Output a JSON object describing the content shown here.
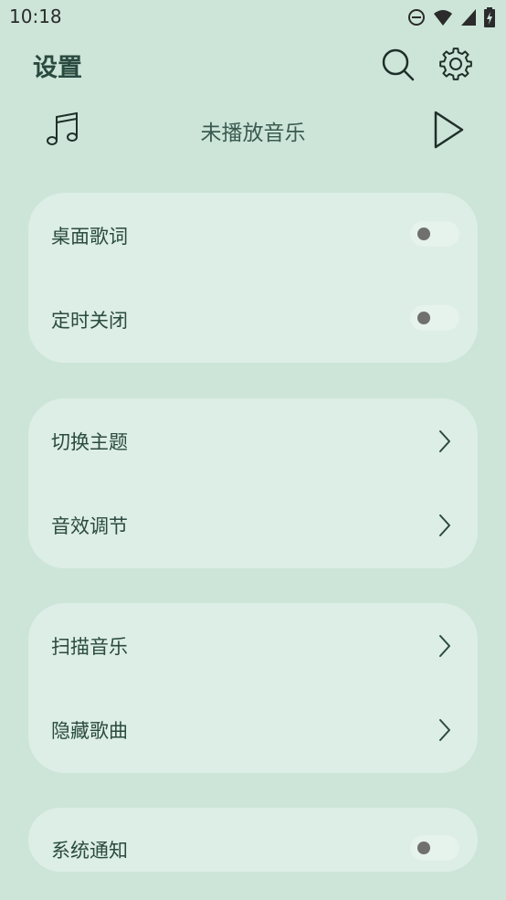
{
  "colors": {
    "background": "#cde5d9",
    "card": "#ddeee6",
    "accent": "#2a4a40"
  },
  "status_bar": {
    "time": "10:18",
    "icons": [
      "dnd-icon",
      "wifi-icon",
      "signal-icon",
      "battery-charging-icon"
    ]
  },
  "header": {
    "title": "设置",
    "icons": [
      "search-icon",
      "gear-icon"
    ]
  },
  "player": {
    "status": "未播放音乐",
    "icons": [
      "music-note-icon",
      "play-icon"
    ]
  },
  "cards": [
    {
      "rows": [
        {
          "label": "桌面歌词",
          "type": "toggle",
          "on": false
        },
        {
          "label": "定时关闭",
          "type": "toggle",
          "on": false
        }
      ]
    },
    {
      "rows": [
        {
          "label": "切换主题",
          "type": "link"
        },
        {
          "label": "音效调节",
          "type": "link"
        }
      ]
    },
    {
      "rows": [
        {
          "label": "扫描音乐",
          "type": "link"
        },
        {
          "label": "隐藏歌曲",
          "type": "link"
        }
      ]
    },
    {
      "rows": [
        {
          "label": "系统通知",
          "type": "toggle",
          "on": false
        }
      ]
    }
  ]
}
